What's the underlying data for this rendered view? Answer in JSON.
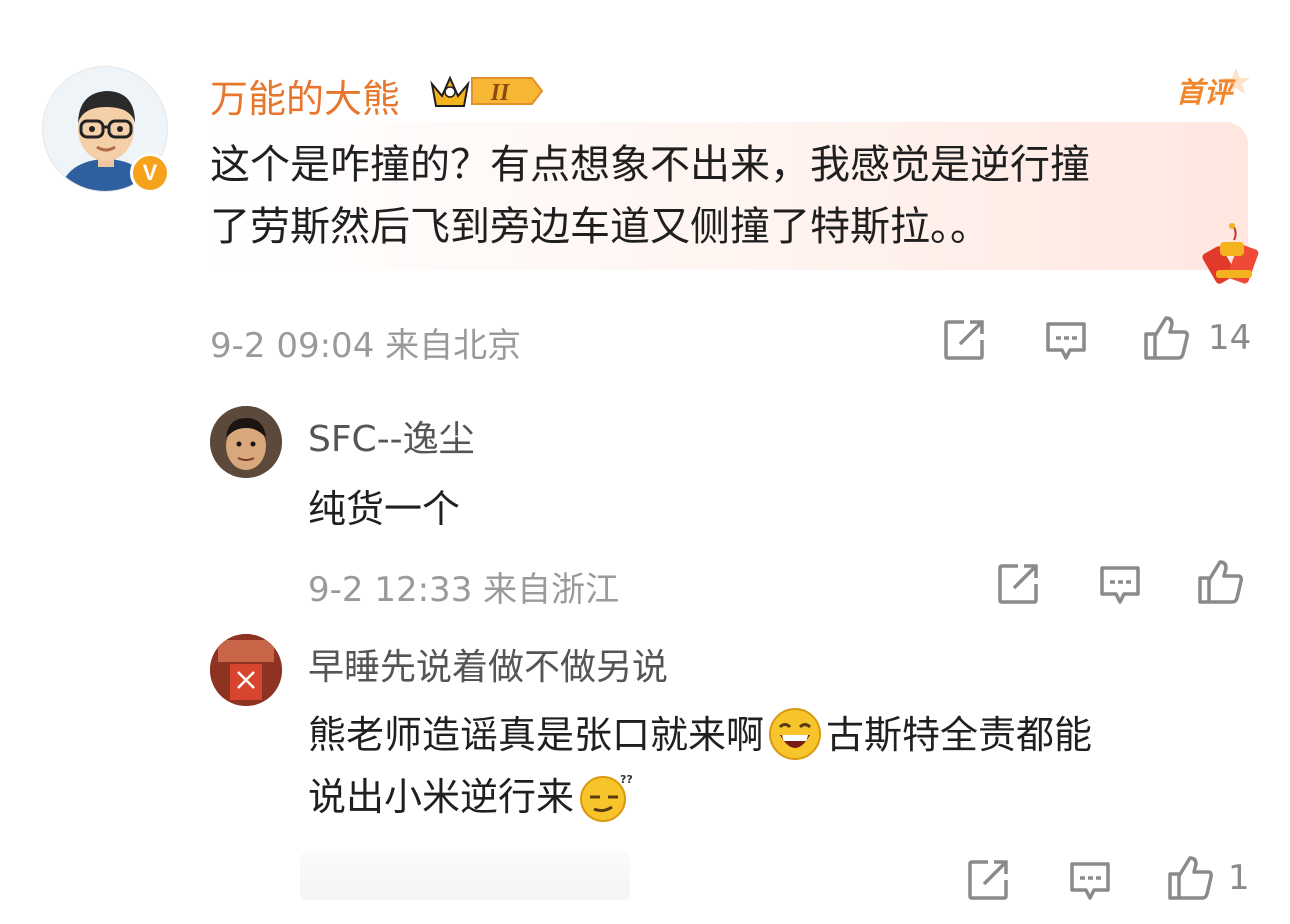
{
  "main_comment": {
    "username": "万能的大熊",
    "level_badge": "II",
    "first_comment_tag": "首评",
    "content_line1": "这个是咋撞的？有点想象不出来，我感觉是逆行撞",
    "content_line2": "了劳斯然后飞到旁边车道又侧撞了特斯拉。。",
    "timestamp": "9-2 09:04",
    "location": "来自北京",
    "like_count": "14",
    "verified_badge": "V",
    "icons": [
      "share-icon",
      "comment-icon",
      "like-icon",
      "crown-icon",
      "firecracker-icon"
    ]
  },
  "replies": [
    {
      "username": "SFC--逸尘",
      "content": "纯货一个",
      "timestamp": "9-2 12:33",
      "location": "来自浙江",
      "like_count": ""
    },
    {
      "username": "早睡先说着做不做另说",
      "content_line1_a": "熊老师造谣真是张口就来啊",
      "content_line1_b": "古斯特全责都能",
      "content_line2": "说出小米逆行来",
      "like_count": "1",
      "emojis": [
        "laughing-emoji",
        "confused-emoji"
      ]
    }
  ],
  "colors": {
    "username_vip": "#e8762c",
    "meta_text": "#9a9a9a",
    "icon_gray": "#8a8a8a",
    "verified_badge": "#f7a21b"
  }
}
